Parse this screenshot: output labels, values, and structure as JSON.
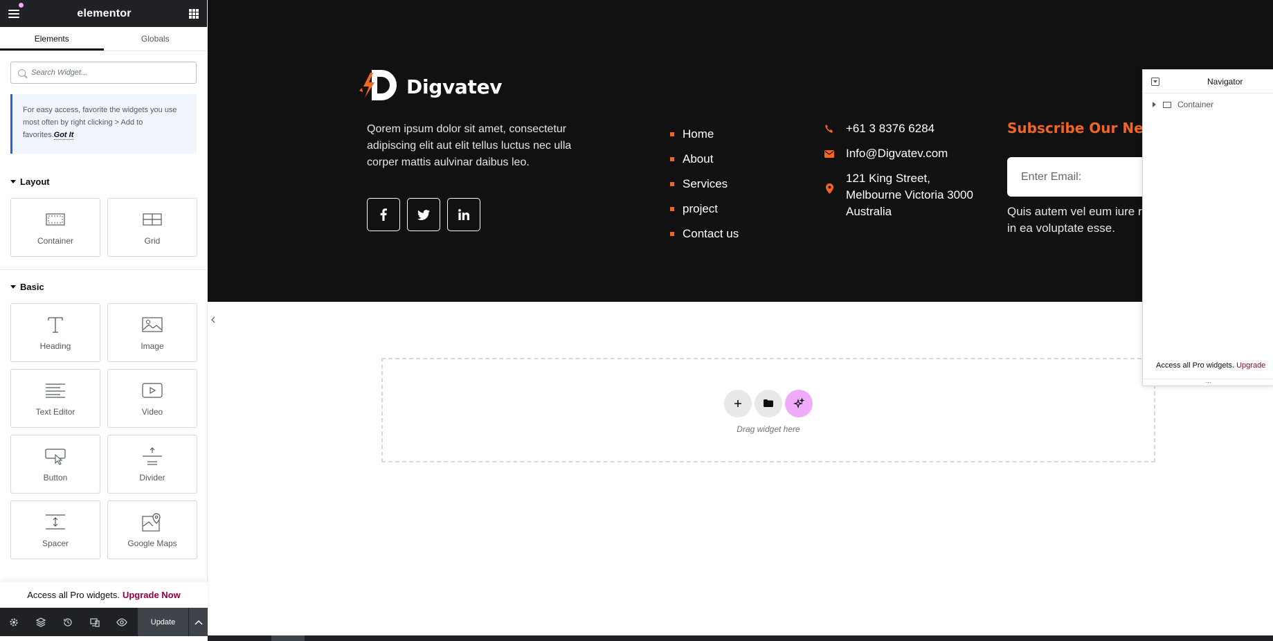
{
  "panel": {
    "logo": "elementor",
    "tabs": [
      "Elements",
      "Globals"
    ],
    "search_placeholder": "Search Widget...",
    "tip_text": "For easy access, favorite the widgets you use most often by right clicking > Add to favorites.",
    "tip_link": "Got It",
    "categories": {
      "layout": "Layout",
      "basic": "Basic"
    },
    "layout_widgets": [
      "Container",
      "Grid"
    ],
    "basic_widgets": [
      "Heading",
      "Image",
      "Text Editor",
      "Video",
      "Button",
      "Divider",
      "Spacer",
      "Google Maps"
    ],
    "pro_text": "Access all Pro widgets.",
    "pro_link": "Upgrade Now",
    "update_label": "Update"
  },
  "footer_section": {
    "brand_name": "Digvatev",
    "description": "Qorem ipsum dolor sit amet, consectetur adipiscing elit aut elit tellus luctus nec ulla corper mattis aulvinar daibus leo.",
    "links": [
      "Home",
      "About",
      "Services",
      "project",
      "Contact us"
    ],
    "phone": "+61 3 8376 6284",
    "email": "Info@Digvatev.com",
    "address": "121 King Street, Melbourne Victoria 3000 Australia",
    "subscribe_title": "Subscribe Our New",
    "email_placeholder": "Enter Email:",
    "subscribe_desc": "Quis autem vel eum iure re rui in ea voluptate esse."
  },
  "dropzone": {
    "text": "Drag widget here"
  },
  "navigator": {
    "title": "Navigator",
    "item": "Container",
    "pro_text": "Access all Pro widgets.",
    "pro_link": "Upgrade",
    "dots": "..."
  },
  "colors": {
    "accent": "#f26522",
    "panel_dark": "#1f2124",
    "upgrade": "#93003f",
    "ai_button": "#f0abfc"
  }
}
